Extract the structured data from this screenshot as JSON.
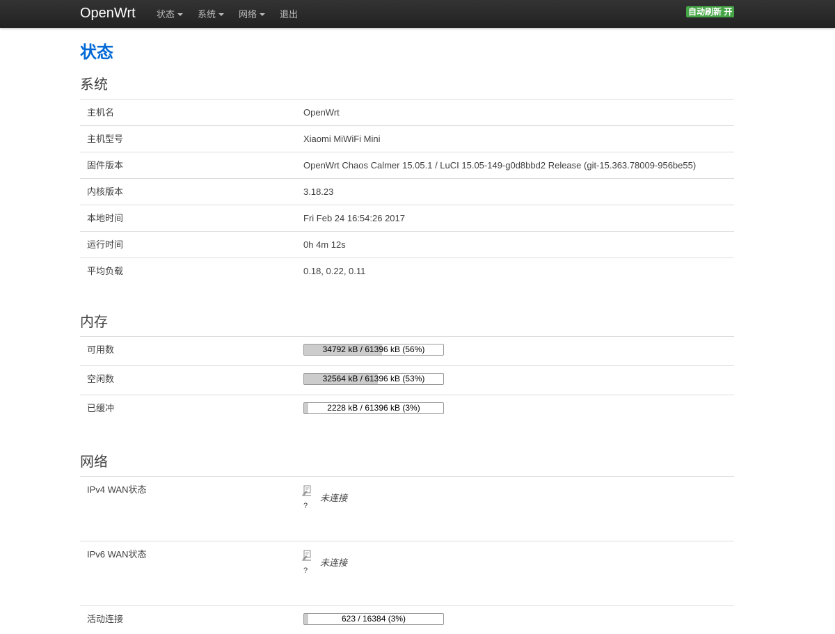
{
  "nav": {
    "brand": "OpenWrt",
    "menu": [
      {
        "label": "状态",
        "dropdown": true
      },
      {
        "label": "系统",
        "dropdown": true
      },
      {
        "label": "网络",
        "dropdown": true
      },
      {
        "label": "退出",
        "dropdown": false
      }
    ],
    "autorefresh": "自动刷新 开"
  },
  "page_title": "状态",
  "system": {
    "title": "系统",
    "rows": [
      {
        "key": "主机名",
        "value": "OpenWrt"
      },
      {
        "key": "主机型号",
        "value": "Xiaomi MiWiFi Mini"
      },
      {
        "key": "固件版本",
        "value": "OpenWrt Chaos Calmer 15.05.1 / LuCI 15.05-149-g0d8bbd2 Release (git-15.363.78009-956be55)"
      },
      {
        "key": "内核版本",
        "value": "3.18.23"
      },
      {
        "key": "本地时间",
        "value": "Fri Feb 24 16:54:26 2017"
      },
      {
        "key": "运行时间",
        "value": "0h 4m 12s"
      },
      {
        "key": "平均负载",
        "value": "0.18, 0.22, 0.11"
      }
    ]
  },
  "memory": {
    "title": "内存",
    "rows": [
      {
        "key": "可用数",
        "text": "34792 kB / 61396 kB (56%)",
        "percent": 56
      },
      {
        "key": "空闲数",
        "text": "32564 kB / 61396 kB (53%)",
        "percent": 53
      },
      {
        "key": "已缓冲",
        "text": "2228 kB / 61396 kB (3%)",
        "percent": 3
      }
    ]
  },
  "network": {
    "title": "网络",
    "ipv4": {
      "key": "IPv4 WAN状态",
      "icon_caption": "?",
      "status": "未连接"
    },
    "ipv6": {
      "key": "IPv6 WAN状态",
      "icon_caption": "?",
      "status": "未连接"
    },
    "connections": {
      "key": "活动连接",
      "text": "623 / 16384 (3%)",
      "percent": 3
    }
  },
  "colors": {
    "navbar": "#222222",
    "title_blue": "#0069d6",
    "badge_green": "#46a546",
    "bar_fill": "#cccccc"
  }
}
